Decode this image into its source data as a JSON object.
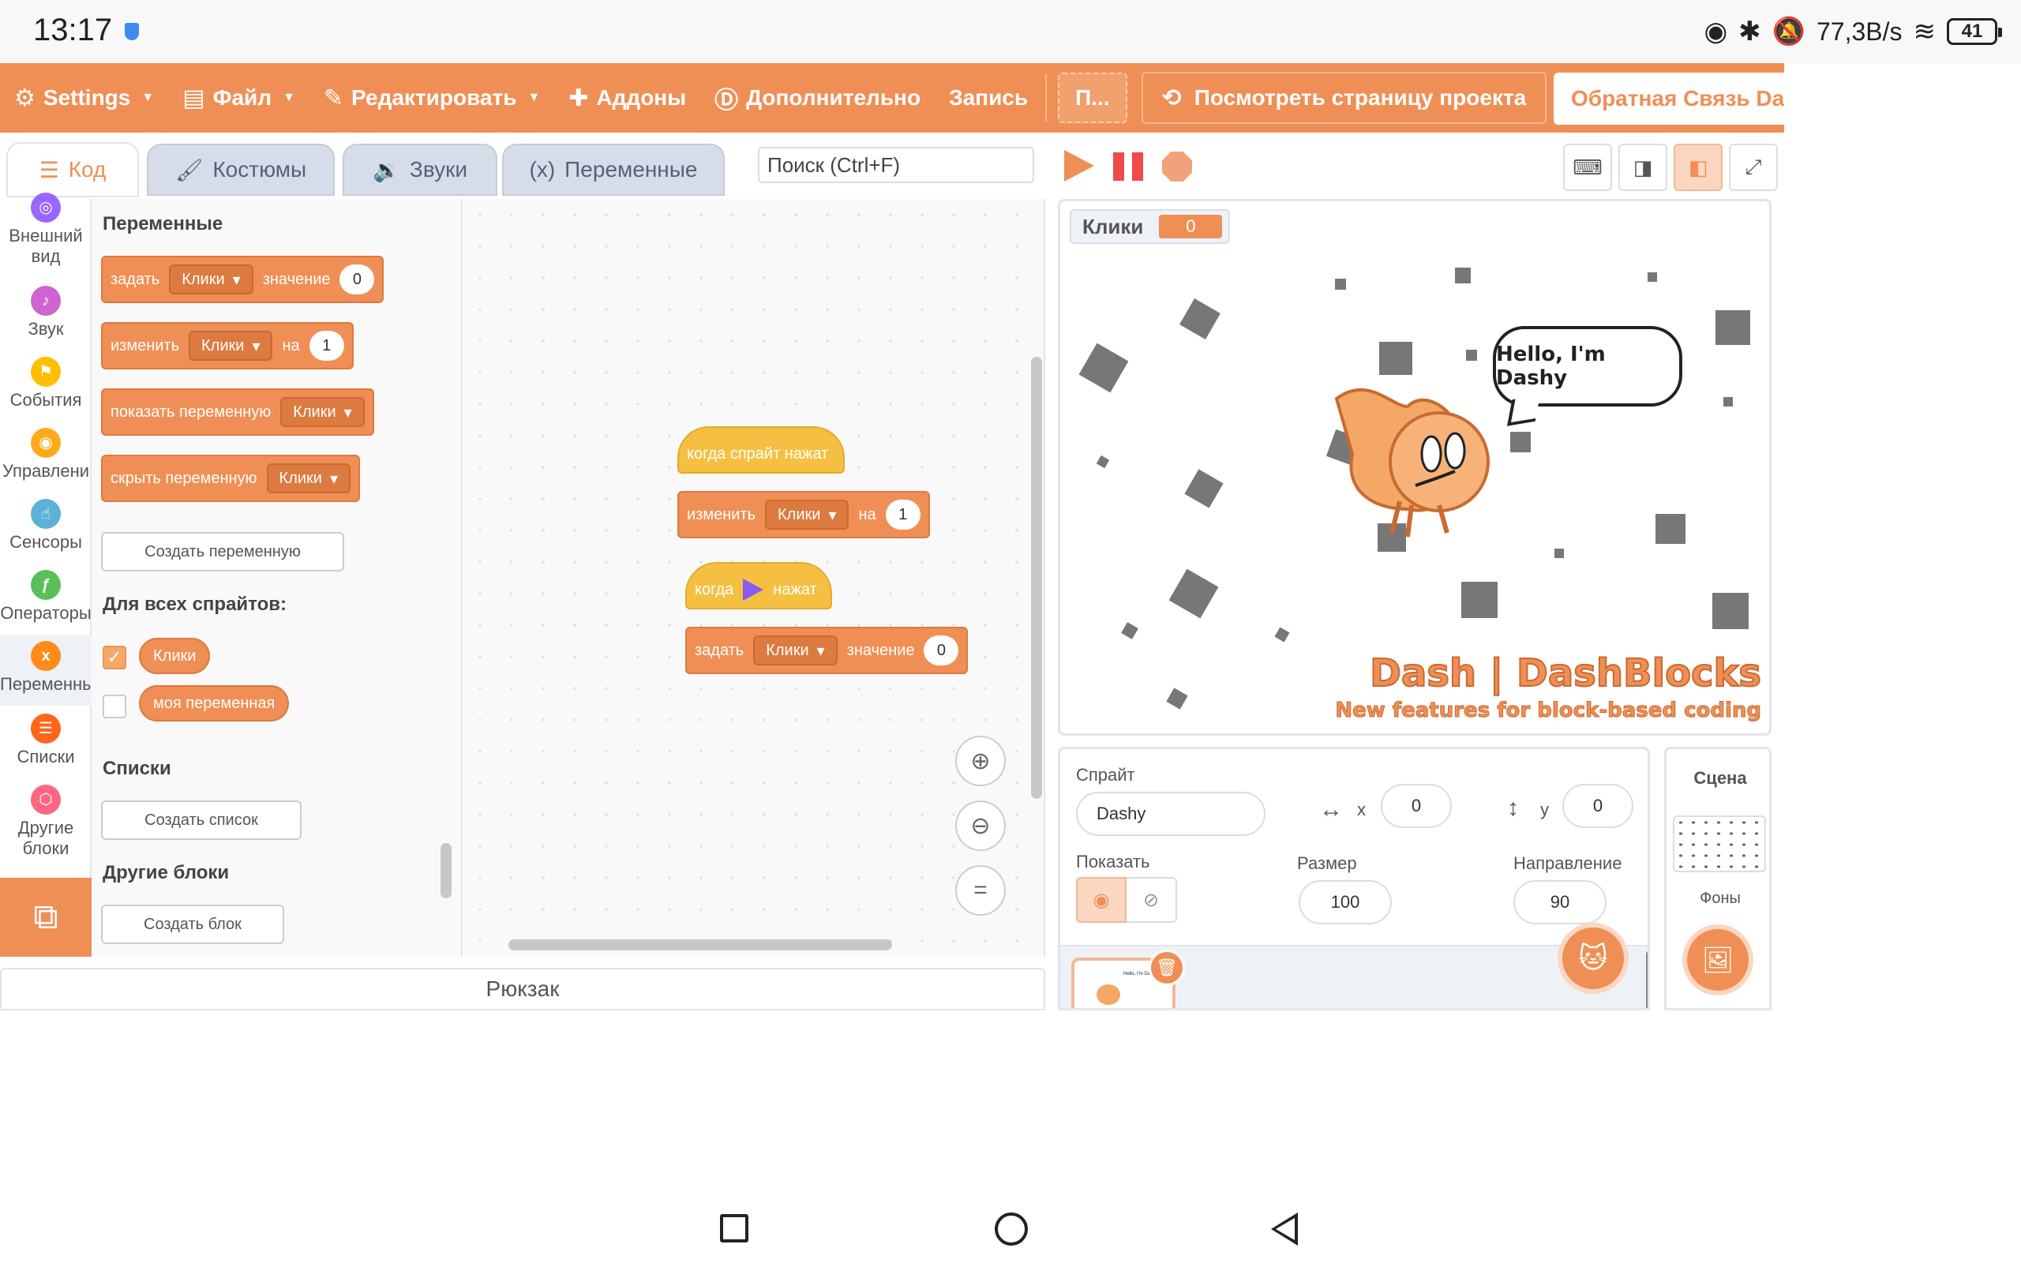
{
  "status_bar": {
    "time": "13:17",
    "net_speed": "77,3B/s",
    "battery": "41",
    "icons": [
      "shield-icon",
      "eye-icon",
      "bluetooth-icon",
      "mute-icon",
      "wifi-icon",
      "battery-icon"
    ]
  },
  "menubar": {
    "settings": "Settings",
    "file": "Файл",
    "edit": "Редактировать",
    "addons": "Аддоны",
    "extra": "Дополнительно",
    "record": "Запись",
    "project_title": "П...",
    "see_project_page": "Посмотреть страницу проекта",
    "feedback": "Обратная Связь Dash"
  },
  "tabs": {
    "code": "Код",
    "costumes": "Костюмы",
    "sounds": "Звуки",
    "variables": "Переменные"
  },
  "search": {
    "placeholder": "Поиск (Ctrl+F)"
  },
  "categories": [
    {
      "label": "Внешний вид",
      "color": "#9966ff",
      "icon": "looks-icon"
    },
    {
      "label": "Звук",
      "color": "#cf63cf",
      "icon": "sound-icon"
    },
    {
      "label": "События",
      "color": "#ffbf00",
      "icon": "events-icon"
    },
    {
      "label": "Управлени",
      "color": "#ffab19",
      "icon": "control-icon"
    },
    {
      "label": "Сенсоры",
      "color": "#5cb1d6",
      "icon": "sensing-icon"
    },
    {
      "label": "Операторы",
      "color": "#59c059",
      "icon": "operators-icon"
    },
    {
      "label": "Переменны",
      "color": "#ff8c1a",
      "icon": "variables-icon"
    },
    {
      "label": "Списки",
      "color": "#ff661a",
      "icon": "lists-icon"
    },
    {
      "label": "Другие блоки",
      "color": "#ff6680",
      "icon": "myblocks-icon"
    }
  ],
  "palette": {
    "section_variables": "Переменные",
    "set_block": {
      "word1": "задать",
      "var": "Клики",
      "word2": "значение",
      "value": "0"
    },
    "change_block": {
      "word1": "изменить",
      "var": "Клики",
      "word2": "на",
      "value": "1"
    },
    "show_block": {
      "word1": "показать переменную",
      "var": "Клики"
    },
    "hide_block": {
      "word1": "скрыть переменную",
      "var": "Клики"
    },
    "make_variable": "Создать переменную",
    "for_all_sprites": "Для всех спрайтов:",
    "var1": "Клики",
    "var2": "моя переменная",
    "section_lists": "Списки",
    "make_list": "Создать список",
    "section_myblocks": "Другие блоки",
    "make_block": "Создать блок"
  },
  "scripts": {
    "script1": {
      "hat": "когда спрайт нажат",
      "word1": "изменить",
      "var": "Клики",
      "word2": "на",
      "value": "1"
    },
    "script2": {
      "hat_word1": "когда",
      "hat_word2": "нажат",
      "word1": "задать",
      "var": "Клики",
      "word2": "значение",
      "value": "0"
    }
  },
  "backpack": "Рюкзак",
  "stage": {
    "monitor_label": "Клики",
    "monitor_value": "0",
    "speech": "Hello, I'm Dashy",
    "logo_line1": "Dash | DashBlocks",
    "logo_line2": "New features for block-based coding"
  },
  "sprite_info": {
    "sprite_label": "Спрайт",
    "sprite_name": "Dashy",
    "x_label": "x",
    "x": "0",
    "y_label": "y",
    "y": "0",
    "show_label": "Показать",
    "size_label": "Размер",
    "size": "100",
    "direction_label": "Направление",
    "direction": "90",
    "thumb_text": "Hello, I'm Dashy"
  },
  "scene": {
    "title": "Сцена",
    "backdrops_label": "Фоны"
  },
  "colors": {
    "accent": "#f08f55",
    "hat": "#f5c042",
    "variable_block": "#f08f55"
  }
}
